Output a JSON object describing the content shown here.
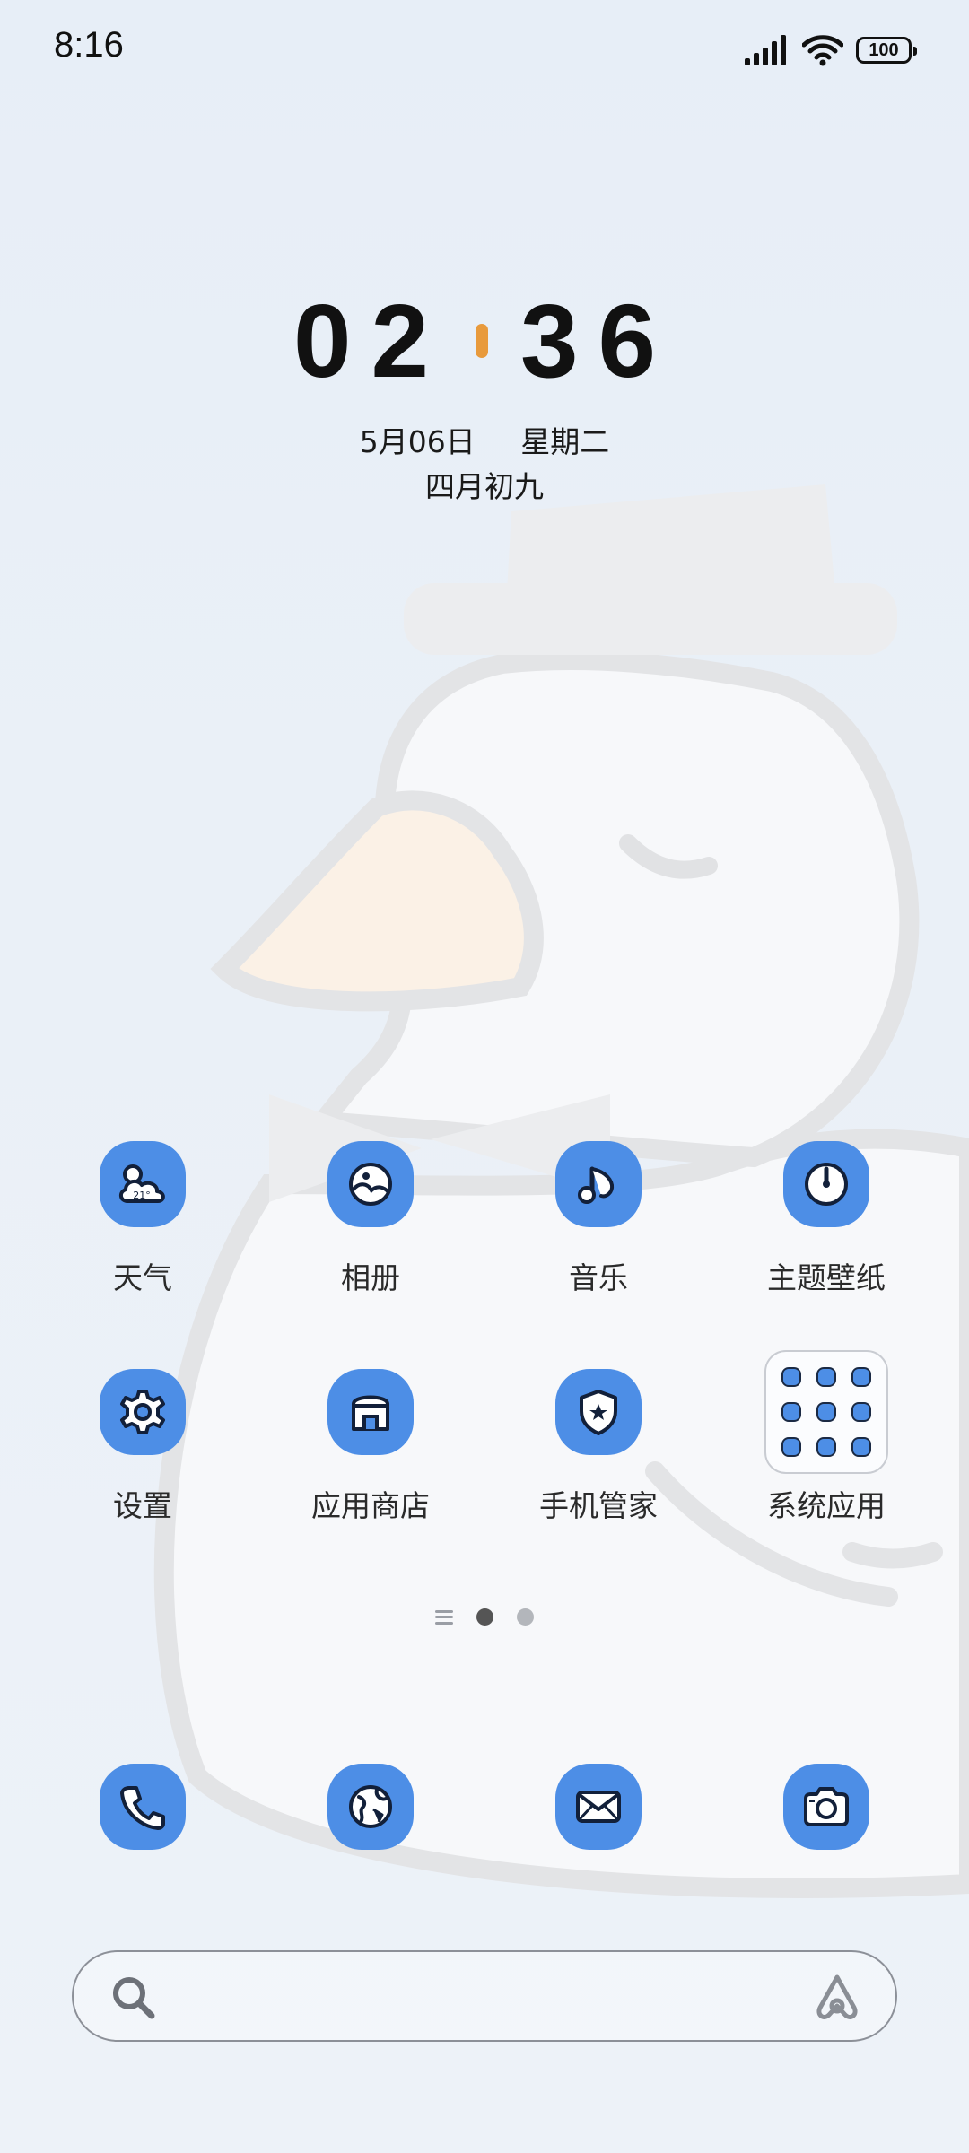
{
  "status_bar": {
    "time": "8:16",
    "battery": "100"
  },
  "lock_clock": {
    "hours": "02",
    "minutes": "36",
    "date": "5月06日",
    "weekday": "星期二",
    "lunar": "四月初九",
    "separator_color": "#e89a3c"
  },
  "apps": [
    {
      "label": "天气",
      "icon": "weather-icon",
      "badge": "21°"
    },
    {
      "label": "相册",
      "icon": "gallery-icon"
    },
    {
      "label": "音乐",
      "icon": "music-icon"
    },
    {
      "label": "主题壁纸",
      "icon": "theme-icon"
    },
    {
      "label": "设置",
      "icon": "gear-icon"
    },
    {
      "label": "应用商店",
      "icon": "store-icon"
    },
    {
      "label": "手机管家",
      "icon": "shield-icon"
    },
    {
      "label": "系统应用",
      "icon": "folder-icon"
    }
  ],
  "pager": {
    "pages": 2,
    "active": 1
  },
  "dock": [
    {
      "icon": "phone-icon"
    },
    {
      "icon": "browser-icon"
    },
    {
      "icon": "mail-icon"
    },
    {
      "icon": "camera-icon"
    }
  ],
  "colors": {
    "accent": "#4d8ee6",
    "icon_stroke": "#12203a"
  }
}
